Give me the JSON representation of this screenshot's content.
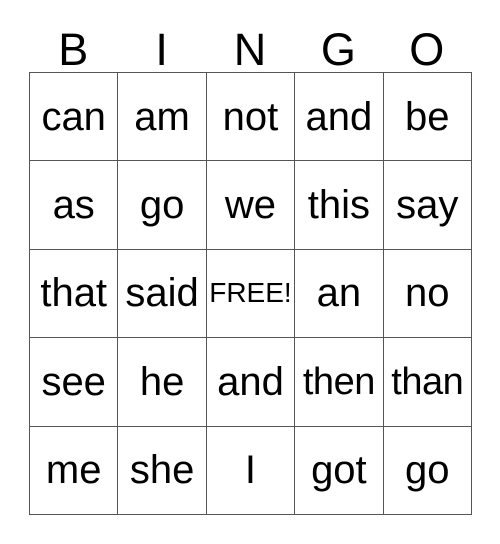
{
  "card": {
    "headers": [
      "B",
      "I",
      "N",
      "G",
      "O"
    ],
    "rows": [
      [
        "can",
        "am",
        "not",
        "and",
        "be"
      ],
      [
        "as",
        "go",
        "we",
        "this",
        "say"
      ],
      [
        "that",
        "said",
        "FREE!",
        "an",
        "no"
      ],
      [
        "see",
        "he",
        "and",
        "then",
        "than"
      ],
      [
        "me",
        "she",
        "I",
        "got",
        "go"
      ]
    ],
    "free_space": {
      "row": 2,
      "col": 2,
      "label": "FREE!"
    },
    "colors": {
      "background": "#ffffff",
      "border": "#555555",
      "text": "#000000"
    }
  }
}
